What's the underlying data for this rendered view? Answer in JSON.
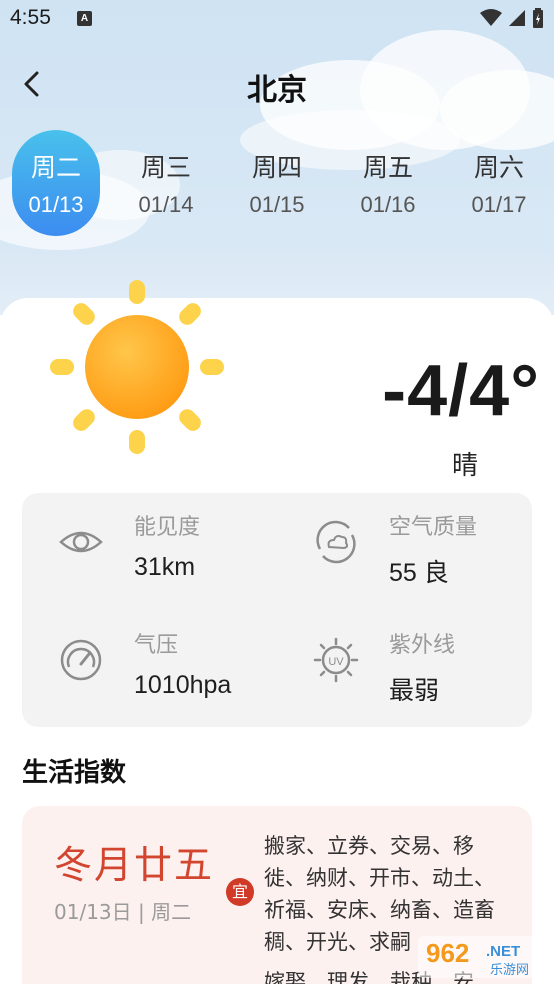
{
  "status_bar": {
    "time": "4:55",
    "notification_icon": "A"
  },
  "header": {
    "title": "北京",
    "back_icon": "chevron-left-icon"
  },
  "days": [
    {
      "weekday": "周二",
      "date": "01/13",
      "selected": true
    },
    {
      "weekday": "周三",
      "date": "01/14",
      "selected": false
    },
    {
      "weekday": "周四",
      "date": "01/15",
      "selected": false
    },
    {
      "weekday": "周五",
      "date": "01/16",
      "selected": false
    },
    {
      "weekday": "周六",
      "date": "01/17",
      "selected": false
    }
  ],
  "current": {
    "temperature": "-4/4°",
    "condition": "晴",
    "icon": "sun-icon"
  },
  "stats": [
    {
      "label": "能见度",
      "value": "31km",
      "icon": "eye-icon"
    },
    {
      "label": "空气质量",
      "value": "55 良",
      "icon": "air-quality-icon"
    },
    {
      "label": "气压",
      "value": "1010hpa",
      "icon": "pressure-gauge-icon"
    },
    {
      "label": "紫外线",
      "value": "最弱",
      "icon": "uv-icon"
    }
  ],
  "life_index": {
    "title": "生活指数"
  },
  "almanac": {
    "lunar_date": "冬月廿五",
    "date_line": "01/13日 | 周二",
    "yi_badge": "宜",
    "yi_items": "搬家、立券、交易、移徙、纳财、开市、动土、祈福、安床、纳畜、造畜稠、开光、求嗣",
    "yi_more": "嫁娶、理发、栽种、安"
  },
  "watermark": {
    "number": "962",
    "suffix": ".NET",
    "site": "乐游网"
  },
  "colors": {
    "accent": "#3c8cf0",
    "lunar_red": "#d2452f",
    "stats_bg": "#f3f3f3",
    "almanac_bg": "#fdf1ef"
  }
}
